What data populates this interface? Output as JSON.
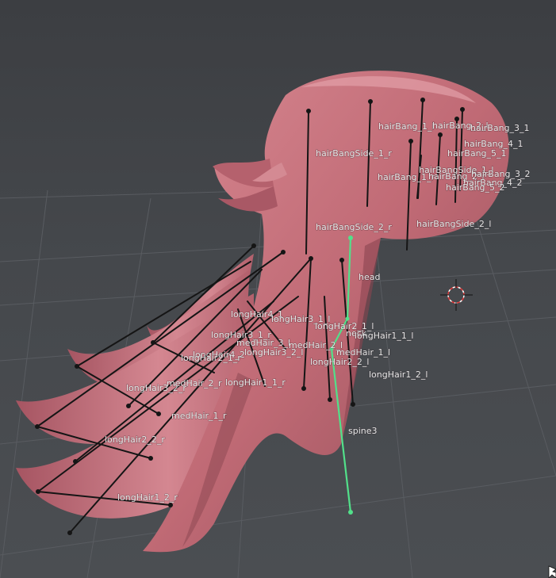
{
  "viewport": {
    "background_top": "#3c3e42",
    "background_bottom": "#4b4e52",
    "grid_color": "#5a5d62",
    "mesh_color": "#c9707a",
    "mesh_shadow": "#8e4b55",
    "bone_color": "#151515",
    "selected_bone_color": "#52e08a"
  },
  "bone_labels": [
    "hairBang_1_l",
    "hairBang_2_l",
    "hairBang_3_1",
    "hairBang_4_1",
    "hairBang_5_1",
    "hairBangSide_1_r",
    "hairBangSide_1_l",
    "hairBang_1_r",
    "hairBang_2_r",
    "hairBang_3_2",
    "hairBang_4_2",
    "hairBang_5_2",
    "hairBangSide_2_r",
    "hairBangSide_2_l",
    "head",
    "longHair4_1",
    "longHair3_1_l",
    "longHair3_1_r",
    "longHair2_1_l",
    "neck",
    "medHair_3_l",
    "longHair1_1_l",
    "medHair_2_l",
    "longHair3_2_l",
    "medHair_1_l",
    "longHair4_2",
    "longHair2_1_r",
    "longHair2_2_l",
    "longHair1_2_l",
    "medHair_2_r",
    "longHair1_1_r",
    "longHair3_2_r",
    "medHair_1_r",
    "longHair2_2_r",
    "spine3",
    "longHair1_2_r"
  ],
  "cursor_icon": "arrow-cursor-icon",
  "pivot_icon": "3d-cursor-icon"
}
